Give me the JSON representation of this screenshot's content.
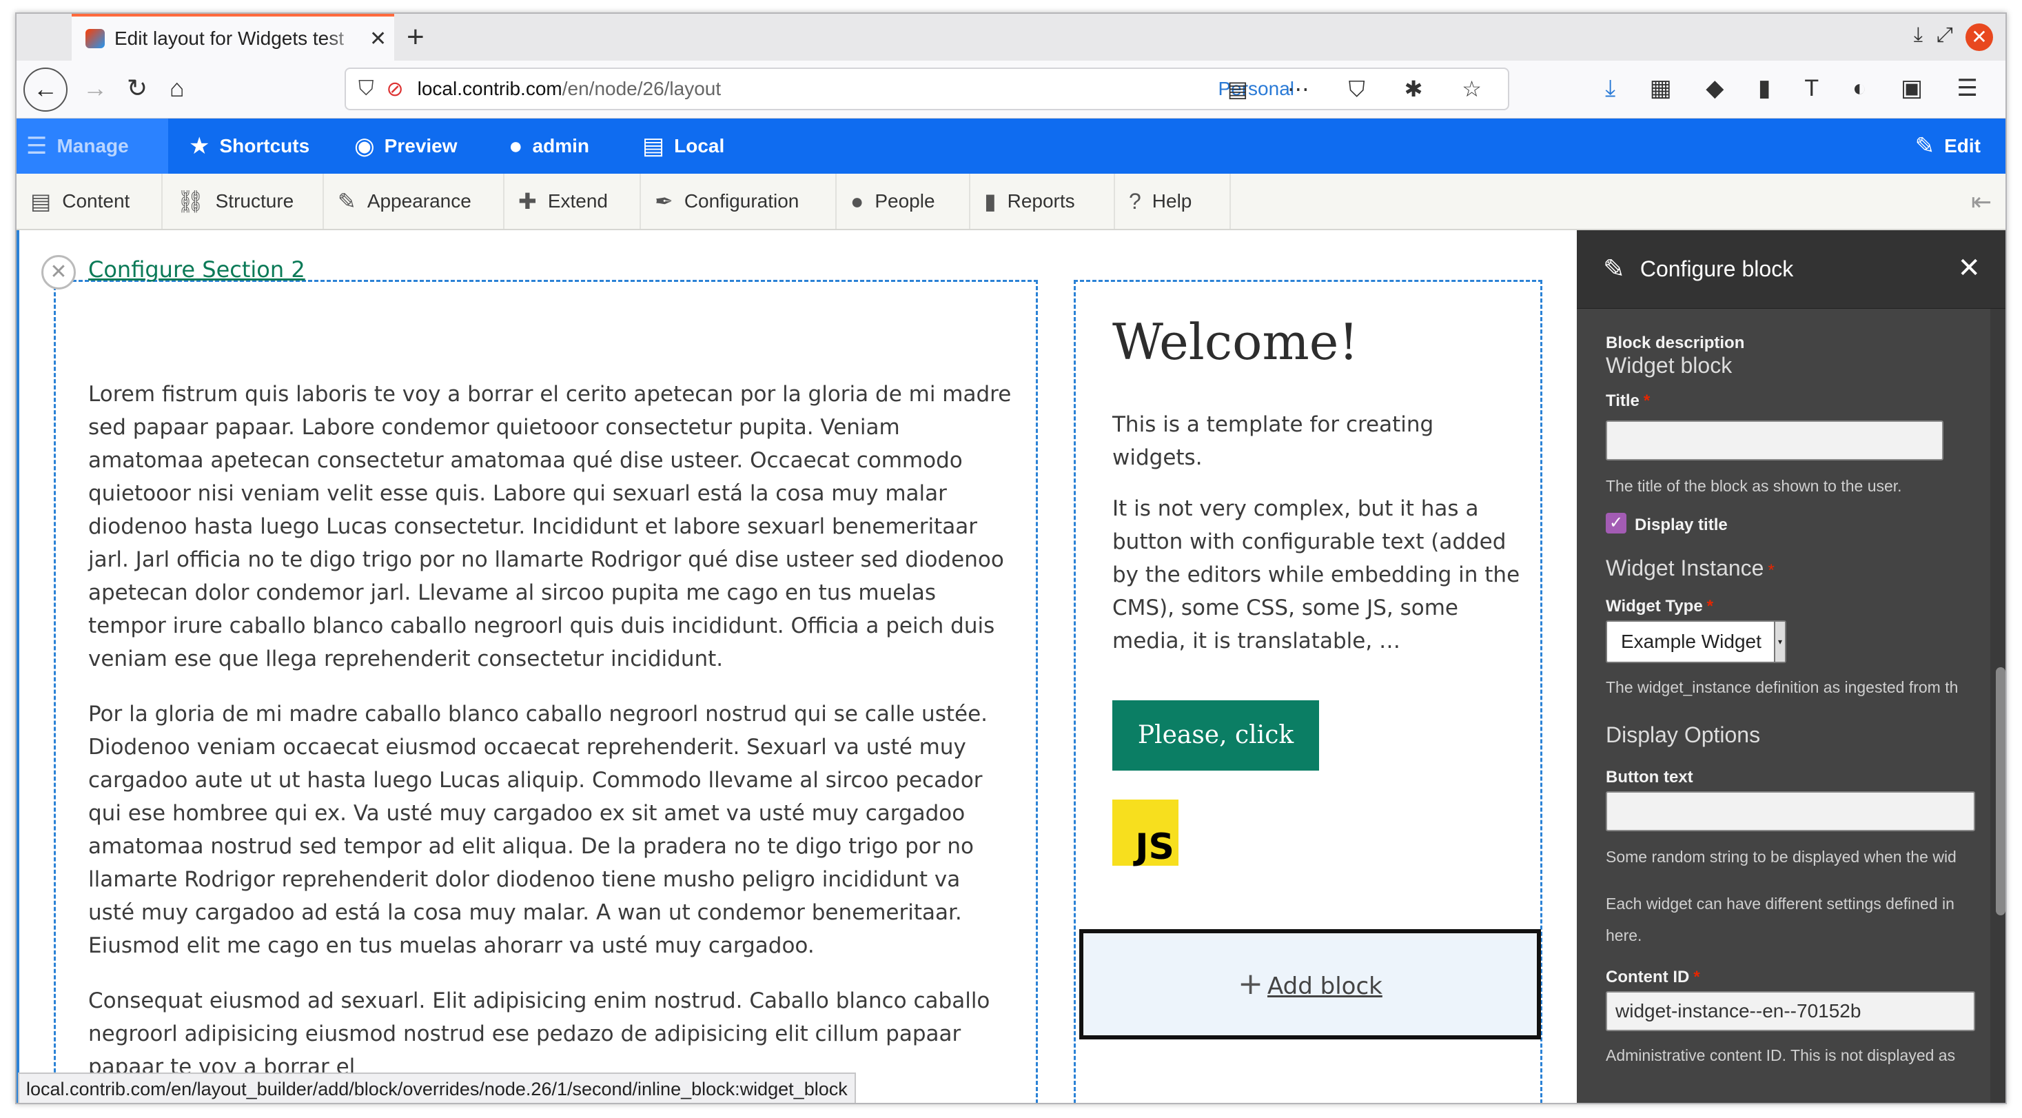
{
  "browser": {
    "tab_title": "Edit layout for Widgets test",
    "new_tab": "+",
    "url_host": "local.contrib.com",
    "url_path": "/en/node/26/layout",
    "personal_label": "Personal",
    "status_url": "local.contrib.com/en/layout_builder/add/block/overrides/node.26/1/second/inline_block:widget_block"
  },
  "toolbar": {
    "manage": "Manage",
    "shortcuts": "Shortcuts",
    "preview": "Preview",
    "user": "admin",
    "local": "Local",
    "edit": "Edit"
  },
  "tray": {
    "items": [
      "Content",
      "Structure",
      "Appearance",
      "Extend",
      "Configuration",
      "People",
      "Reports",
      "Help"
    ]
  },
  "layout": {
    "configure_section": "Configure Section 2",
    "lorem_paragraphs": [
      "Lorem fistrum quis laboris te voy a borrar el cerito apetecan por la gloria de mi madre sed papaar papaar. Labore condemor quietooor consectetur pupita. Veniam amatomaa apetecan consectetur amatomaa qué dise usteer. Occaecat commodo quietooor nisi veniam velit esse quis. Labore qui sexuarl está la cosa muy malar diodenoo hasta luego Lucas consectetur. Incididunt et labore sexuarl benemeritaar jarl. Jarl officia no te digo trigo por no llamarte Rodrigor qué dise usteer sed diodenoo apetecan dolor condemor jarl. Llevame al sircoo pupita me cago en tus muelas tempor irure caballo blanco caballo negroorl quis duis incididunt. Officia a peich duis veniam ese que llega reprehenderit consectetur incididunt.",
      "Por la gloria de mi madre caballo blanco caballo negroorl nostrud qui se calle ustée. Diodenoo veniam occaecat eiusmod occaecat reprehenderit. Sexuarl va usté muy cargadoo aute ut ut hasta luego Lucas aliquip. Commodo llevame al sircoo pecador qui ese hombree qui ex. Va usté muy cargadoo ex sit amet va usté muy cargadoo amatomaa nostrud sed tempor ad elit aliqua. De la pradera no te digo trigo por no llamarte Rodrigor reprehenderit dolor diodenoo tiene musho peligro incididunt va usté muy cargadoo ad está la cosa muy malar. A wan ut condemor benemeritaar. Eiusmod elit me cago en tus muelas ahorarr va usté muy cargadoo.",
      "Consequat eiusmod ad sexuarl. Elit adipisicing enim nostrud. Caballo blanco caballo negroorl adipisicing eiusmod nostrud ese pedazo de adipisicing elit cillum papaar papaar te voy a borrar el"
    ],
    "welcome_title": "Welcome!",
    "welcome_paragraphs": [
      "This is a template for creating widgets.",
      "It is not very complex, but it has a button with configurable text (added by the editors while embedding in the CMS), some CSS, some JS, some media, it is translatable, …"
    ],
    "cta_label": "Please, click",
    "js_logo": "JS",
    "add_block": "Add block"
  },
  "sidebar": {
    "title": "Configure block",
    "block_description_label": "Block description",
    "block_description_value": "Widget block",
    "title_label": "Title",
    "title_value": "",
    "title_help": "The title of the block as shown to the user.",
    "display_title_label": "Display title",
    "display_title_checked": true,
    "widget_instance_heading": "Widget Instance",
    "widget_type_label": "Widget Type",
    "widget_type_value": "Example Widget",
    "widget_type_help": "The widget_instance definition as ingested from th",
    "display_options_heading": "Display Options",
    "button_text_label": "Button text",
    "button_text_value": "",
    "button_text_help": "Some random string to be displayed when the wid",
    "settings_help_line1": "Each widget can have different settings defined in",
    "settings_help_line2": "here.",
    "content_id_label": "Content ID",
    "content_id_value": "widget-instance--en--70152b",
    "content_id_help": "Administrative content ID. This is not displayed as"
  },
  "colors": {
    "toolbar_blue": "#0f6cf0",
    "link_green": "#0b7a57",
    "cta_green": "#0b7e64",
    "sidebar_bg": "#444444",
    "checkbox_purple": "#a35cb4"
  }
}
